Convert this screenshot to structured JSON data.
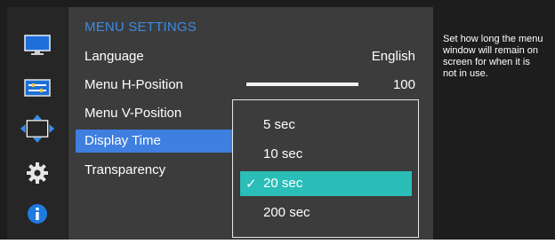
{
  "menu": {
    "title": "MENU SETTINGS",
    "items": [
      {
        "label": "Language",
        "value": "English"
      },
      {
        "label": "Menu H-Position",
        "value": "100"
      },
      {
        "label": "Menu V-Position",
        "value": ""
      },
      {
        "label": "Display Time",
        "value": ""
      },
      {
        "label": "Transparency",
        "value": ""
      }
    ],
    "h_position_level": 1.0
  },
  "dropdown": {
    "options": [
      "5 sec",
      "10 sec",
      "20 sec",
      "200 sec"
    ],
    "selected": "20 sec",
    "check_icon": "checkmark-icon"
  },
  "help": {
    "text": "Set how long the menu\nwindow will remain on\nscreen for when it is\nnot in use."
  },
  "icons": [
    "monitor-icon",
    "picture-adjust-icon",
    "position-arrows-icon",
    "gear-icon",
    "info-icon"
  ],
  "colors": {
    "title": "#3b8be6",
    "selection": "#3e7fe0",
    "option_highlight": "#2bbdb8"
  }
}
